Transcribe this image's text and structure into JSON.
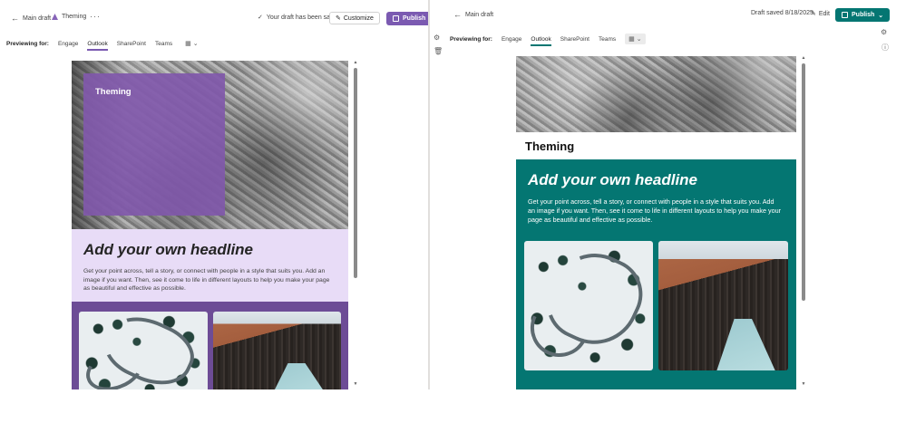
{
  "left_pane": {
    "back_label": "Main draft",
    "breadcrumb_label": "Theming",
    "more_label": "···",
    "status_text": "Your draft has been saved",
    "customize_label": "Customize",
    "publish_label": "Publish",
    "preview_label": "Previewing for:",
    "tabs": [
      "Engage",
      "Outlook",
      "SharePoint",
      "Teams"
    ],
    "active_tab": "Outlook",
    "hero_card_title": "Theming",
    "headline": "Add your own headline",
    "body": "Get your point across, tell a story, or connect with people in a style that suits you. Add an image if you want. Then, see it come to life in different layouts to help you make your page as beautiful and effective as possible."
  },
  "right_pane": {
    "back_label": "Main draft",
    "status_text": "Draft saved 8/18/2025",
    "edit_label": "Edit",
    "publish_label": "Publish",
    "preview_label": "Previewing for:",
    "tabs": [
      "Engage",
      "Outlook",
      "SharePoint",
      "Teams"
    ],
    "active_tab": "Outlook",
    "page_title": "Theming",
    "headline": "Add your own headline",
    "body": "Get your point across, tell a story, or connect with people in a style that suits you. Add an image if you want. Then, see it come to life in different layouts to help you make your page as beautiful and effective as possible."
  },
  "icons": {
    "back": "arrow-left-icon",
    "theme": "theme-icon",
    "check": "checkmark-icon",
    "customize": "paintbrush-icon",
    "publish": "publish-icon",
    "device": "device-preview-icon",
    "chevron": "chevron-down-icon",
    "edit": "pencil-icon"
  },
  "colors": {
    "left_accent": "#7b5ab1",
    "left_headline_bg": "#e8dcf7",
    "left_gallery_bg": "#6d4c96",
    "right_accent": "#047672",
    "right_section_bg": "#047672"
  }
}
